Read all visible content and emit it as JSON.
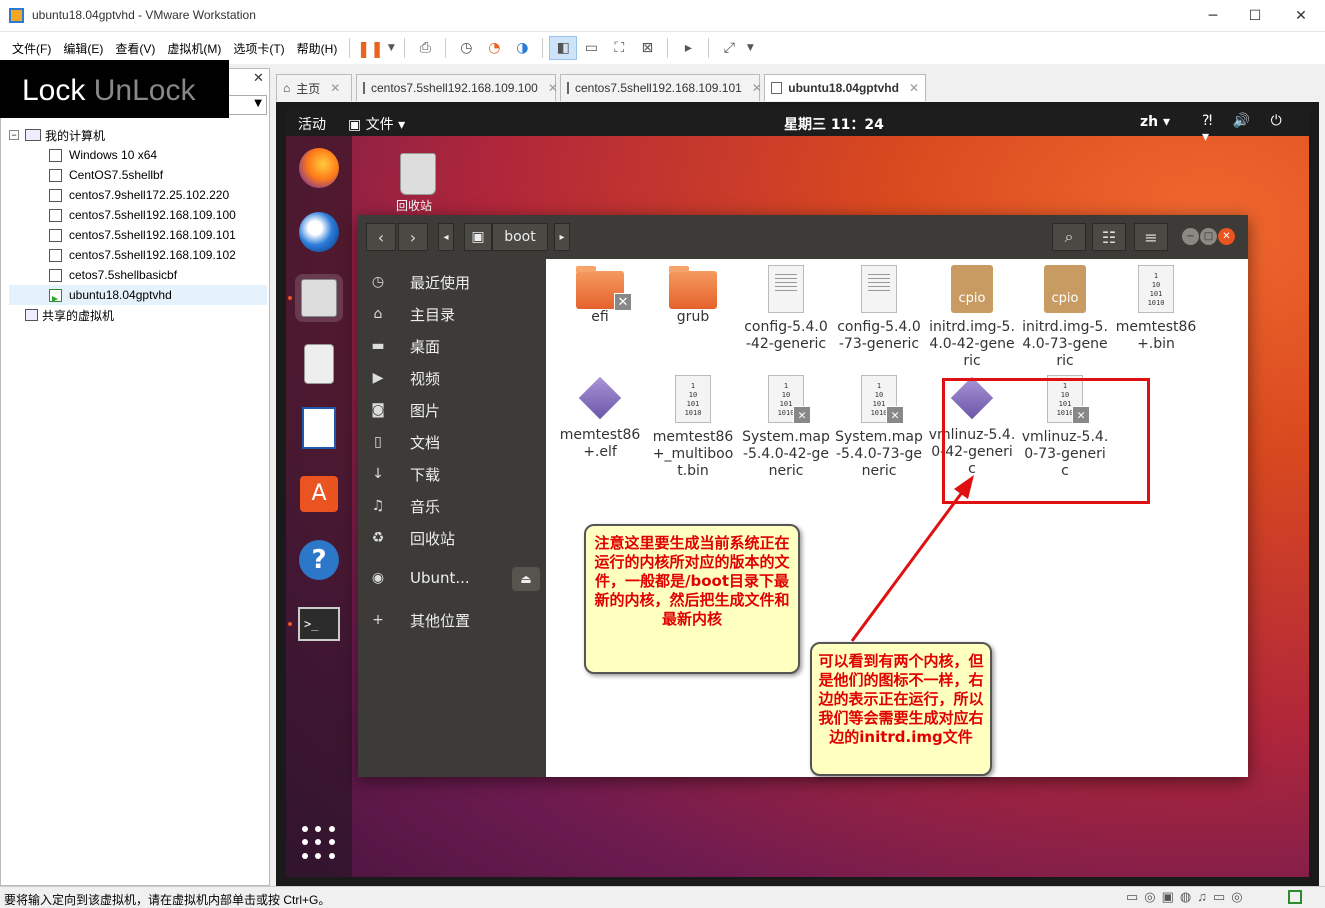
{
  "window": {
    "title": "ubuntu18.04gptvhd - VMware Workstation",
    "controls": [
      "─",
      "☐",
      "✕"
    ]
  },
  "menubar": {
    "items": [
      "文件(F)",
      "编辑(E)",
      "查看(V)",
      "虚拟机(M)",
      "选项卡(T)",
      "帮助(H)"
    ]
  },
  "library": {
    "close_label": "✕",
    "overlay": {
      "lock": "Lock",
      "unlock": "UnLock"
    },
    "root": "我的计算机",
    "vms": [
      "Windows 10 x64",
      "CentOS7.5shellbf",
      "centos7.9shell172.25.102.220",
      "centos7.5shell192.168.109.100",
      "centos7.5shell192.168.109.101",
      "centos7.5shell192.168.109.102",
      "cetos7.5shellbasicbf",
      "ubuntu18.04gptvhd"
    ],
    "shared": "共享的虚拟机"
  },
  "tabs": [
    {
      "label": "主页"
    },
    {
      "label": "centos7.5shell192.168.109.100"
    },
    {
      "label": "centos7.5shell192.168.109.101"
    },
    {
      "label": "ubuntu18.04gptvhd"
    }
  ],
  "ubuntu": {
    "activities": "活动",
    "files_menu": "文件 ▾",
    "clock": "星期三 11：24",
    "lang": "zh ▾",
    "tray": "⁈ 🔊 ⏻ ▾",
    "desktop_trash_label": "回收站"
  },
  "filemanager": {
    "path": "boot",
    "sidebar": [
      {
        "icon": "◷",
        "label": "最近使用"
      },
      {
        "icon": "⌂",
        "label": "主目录"
      },
      {
        "icon": "▬",
        "label": "桌面"
      },
      {
        "icon": "▶",
        "label": "视频"
      },
      {
        "icon": "◙",
        "label": "图片"
      },
      {
        "icon": "▯",
        "label": "文档"
      },
      {
        "icon": "↓",
        "label": "下载"
      },
      {
        "icon": "♫",
        "label": "音乐"
      },
      {
        "icon": "♻",
        "label": "回收站"
      },
      {
        "icon": "◉",
        "label": "Ubunt..."
      },
      {
        "icon": "+",
        "label": "其他位置"
      }
    ],
    "files": [
      {
        "name": "efi",
        "kind": "folder-x"
      },
      {
        "name": "grub",
        "kind": "folder"
      },
      {
        "name": "config-5.4.0-42-generic",
        "kind": "doc"
      },
      {
        "name": "config-5.4.0-73-generic",
        "kind": "doc"
      },
      {
        "name": "initrd.img-5.4.0-42-generic",
        "kind": "cpio"
      },
      {
        "name": "initrd.img-5.4.0-73-generic",
        "kind": "cpio"
      },
      {
        "name": "memtest86+.bin",
        "kind": "bin"
      },
      {
        "name": "memtest86+.elf",
        "kind": "diamond"
      },
      {
        "name": "memtest86+_multiboot.bin",
        "kind": "bin"
      },
      {
        "name": "System.map-5.4.0-42-generic",
        "kind": "bin-x"
      },
      {
        "name": "System.map-5.4.0-73-generic",
        "kind": "bin-x"
      },
      {
        "name": "vmlinuz-5.4.0-42-generic",
        "kind": "diamond"
      },
      {
        "name": "vmlinuz-5.4.0-73-generic",
        "kind": "bin-x"
      }
    ]
  },
  "callouts": {
    "left": "注意这里要生成当前系统正在运行的内核所对应的版本的文件，一般都是/boot目录下最新的内核，然后把生成文件和最新内核",
    "right": "可以看到有两个内核，但是他们的图标不一样，右边的表示正在运行，所以我们等会需要生成对应右边的initrd.img文件"
  },
  "status": {
    "message": "要将输入定向到该虚拟机，请在虚拟机内部单击或按 Ctrl+G。"
  },
  "colors": {
    "ubuntu_orange": "#e95420",
    "annotation_red": "#e01010",
    "callout_bg": "#ffffc0"
  }
}
